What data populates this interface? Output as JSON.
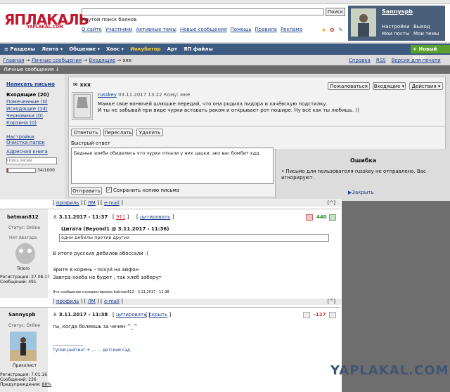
{
  "header": {
    "logo": "ЯПЛАКАЛЬ",
    "logo_sub": "YAPLAKAL.COM",
    "search_placeholder": "",
    "search_button": "Поиск",
    "search_hint": "Крутой поиск баянов",
    "links": [
      "О сайте",
      "Участники",
      "Активные темы",
      "Новые сообщения",
      "Помощь",
      "Правила",
      "Реклама"
    ]
  },
  "user": {
    "name": "Sannyspb",
    "links": [
      "Настройки",
      "Мои посты",
      "Выход",
      "Мои темы"
    ]
  },
  "nav": {
    "items": [
      "Разделы",
      "Лента",
      "Общение",
      "Хаос",
      "Инкубатор",
      "Арт",
      "ЯП файлы"
    ],
    "new_post": "Новый пост"
  },
  "crumbs": [
    "Главная",
    "Личные сообщения",
    "Входящие",
    "xxx"
  ],
  "right_links": [
    "Справка",
    "RSS",
    "Версия для печати"
  ],
  "section_title": "Личные сообщения",
  "sidebar": {
    "compose": "Написать письмо",
    "inbox": "Входящие (20)",
    "marked": "Помеченные (0)",
    "outbox": "Исходящие (14)",
    "drafts": "Черновики (0)",
    "trash": "Корзина (0)",
    "settings": "Настройки",
    "clear": "Очистка папок",
    "address": "Адресная книга",
    "search_placeholder": "Поиск писем",
    "quota": "34/1000"
  },
  "message": {
    "subject": "xxx",
    "author": "russkey",
    "date": "03.11.2017 13:22",
    "to": "Кому: мне",
    "body1": "Мамке свое вонючей шлюшке передай, что она родила пидора и хачёвскую подстилку.",
    "body2": "И ты не забывай при виде чурки вставать раком и открывает рот пошире. Ну всё как ты любишь. ))",
    "btn_complain": "Пожаловаться",
    "btn_inbox": "Входящие",
    "btn_actions": "Действия",
    "btn_reply": "Ответить",
    "btn_forward": "Переслать",
    "btn_delete": "Удалить",
    "quick_reply": "Быстрый ответ",
    "reply_text": "Бедные зомби обиделись что чурки откали у них цацки, эко вас бомбит хдд",
    "btn_send": "Отправить",
    "save_copy": "Сохранить копию письма"
  },
  "error": {
    "title": "Ошибка",
    "text": "Письмо для пользователя russkey не отправлено. Вас игнорируют.",
    "close": "Закрыть"
  },
  "post_links": [
    "профиль",
    "ЛМ",
    "e-mail"
  ],
  "post1": {
    "author": "batman812",
    "status": "Статус: Online",
    "avatar_label": "Нет Аватара",
    "avatar_name": "Totoro",
    "reg": "Регистрация: 27.08.17",
    "msgs": "Сообщений: 491",
    "date": "3.11.2017 - 11:37",
    "num": "911",
    "quote_btn": "цитировать",
    "rating": "440",
    "quote_head": "Цитата (Beyond1 @ 3.11.2017 - 11:36)",
    "quote_text": "одни дебилы против других",
    "line1": "В итоге русских дебилов обоссали :)",
    "line2": "Зрите в корень - похуй на айфон",
    "line3": "Завтра хоеба не будет , так хлеб заберут",
    "edited": "Это сообщение отредактировал batman812 - 3.11.2017 - 11:38"
  },
  "post2": {
    "author": "Sannyspb",
    "status": "Статус: Online",
    "avatar_name": "Приколист",
    "reg": "Регистрация: 7.01.16",
    "msgs": "Сообщений: 236",
    "warn": "Предупреждения:",
    "warn_val": "80%",
    "date": "3.11.2017 - 11:38",
    "quote_btn": "цитировать",
    "hide_btn": "скрыть",
    "rating": "-127",
    "line1": "гы, когда болеешь за чечен ^_^",
    "sig_sep": "--------------------",
    "sig": "Тупой рейтинг + , - ... детский сад."
  },
  "watermark": "YAPLAKAL.COM"
}
